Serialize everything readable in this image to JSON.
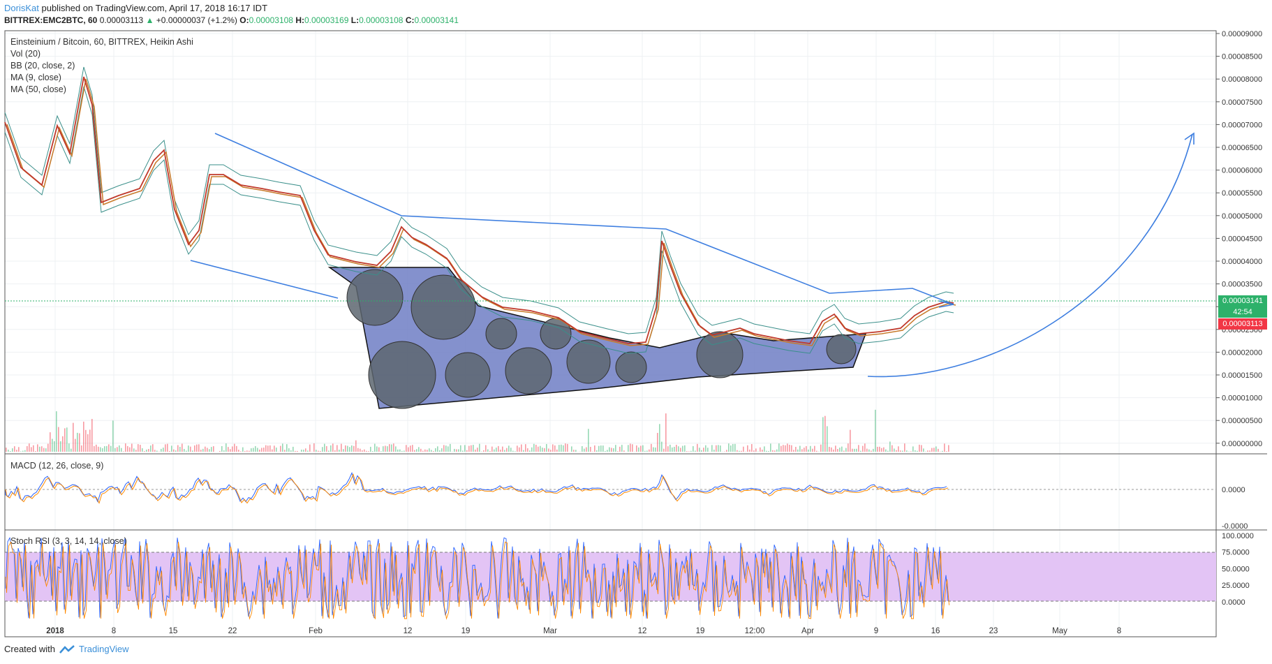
{
  "header": {
    "author": "DorisKat",
    "published_text": "published on TradingView.com, April 17, 2018 16:17 IDT"
  },
  "ohlc": {
    "symbol": "BITTREX:EMC2BTC, 60",
    "last": "0.00003113",
    "change": "+0.00000037 (+1.2%)",
    "open_label": "O:",
    "open": "0.00003108",
    "high_label": "H:",
    "high": "0.00003169",
    "low_label": "L:",
    "low": "0.00003108",
    "close_label": "C:",
    "close": "0.00003141",
    "up_arrow": "▲"
  },
  "legend": {
    "main_title": "Einsteinium / Bitcoin, 60, BITTREX, Heikin Ashi",
    "vol": "Vol (20)",
    "bb": "BB (20, close, 2)",
    "ma9": "MA (9, close)",
    "ma50": "MA (50, close)",
    "macd": "MACD (12, 26, close, 9)",
    "stoch": "Stoch RSI (3, 3, 14, 14, close)"
  },
  "price_axis": [
    "0.00009000",
    "0.00008500",
    "0.00008000",
    "0.00007500",
    "0.00007000",
    "0.00006500",
    "0.00006000",
    "0.00005500",
    "0.00005000",
    "0.00004500",
    "0.00004000",
    "0.00003500",
    "0.00003000",
    "0.00002500",
    "0.00002000",
    "0.00001500",
    "0.00001000",
    "0.00000500",
    "0.00000000"
  ],
  "price_tags": {
    "close": "0.00003141",
    "timer": "42:54",
    "last": "0.00003113"
  },
  "macd_axis": [
    "0.0000",
    "-0.0000"
  ],
  "stoch_axis": [
    "100.0000",
    "75.0000",
    "50.0000",
    "25.0000",
    "0.0000"
  ],
  "time_axis": [
    "2018",
    "8",
    "15",
    "22",
    "Feb",
    "12",
    "19",
    "Mar",
    "12",
    "19",
    "12:00",
    "Apr",
    "9",
    "16",
    "23",
    "May",
    "8"
  ],
  "colors": {
    "line": "#2962ff",
    "trend": "#3d7ee0",
    "shape_fill": "#6f7ec4",
    "bubble": "#5d6670",
    "ma_red": "#c0392b",
    "ma_orange": "#c87a2a",
    "bb_teal": "#3a8f8a",
    "stoch_band": "#e3c4f5",
    "up": "#2db16a",
    "down": "#f23645"
  },
  "footer": {
    "created_with": "Created with",
    "brand": "TradingView"
  }
}
